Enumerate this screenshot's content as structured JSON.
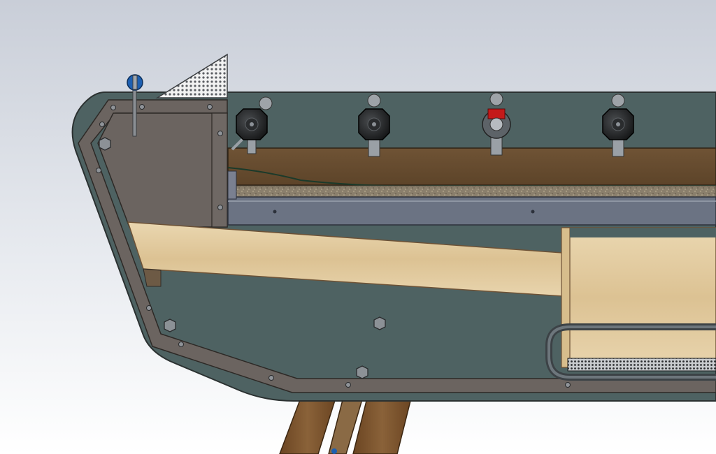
{
  "scene": {
    "kind": "cad-render-side-section",
    "background_top": "#c9ced8",
    "background_bottom": "#ffffff"
  },
  "colors": {
    "housing_panel": "#4e6262",
    "housing_outline": "#2b3131",
    "frame_brown": "#6b6460",
    "wood_light": "#e2cda3",
    "wood_mid": "#cdb38a",
    "wood_dark": "#6d5236",
    "conveyor_slate": "#6b7383",
    "mesh_gray": "#8d9196",
    "roller_black": "#1f2122",
    "valve_red": "#c41a1a",
    "cap_blue": "#1d5fb1",
    "leg_wood": "#7a5530"
  },
  "components": {
    "rollers": [
      "roller",
      "roller",
      "roller-with-red-valve",
      "roller"
    ],
    "hopper": "mesh-hopper",
    "screen": "mesh-screen",
    "cap": "blue-cap-knob"
  }
}
